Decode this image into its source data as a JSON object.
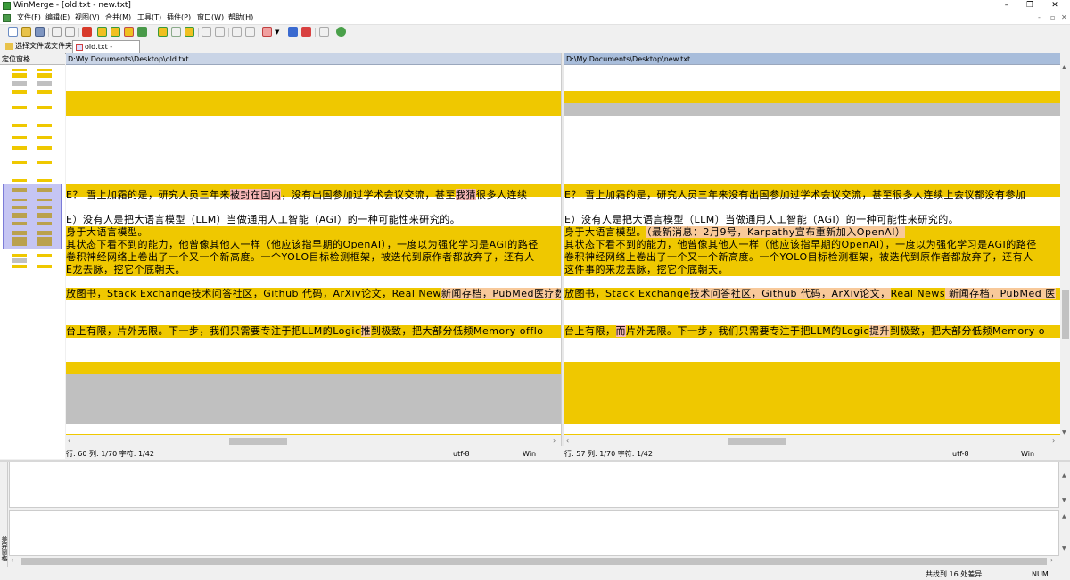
{
  "window": {
    "title": "WinMerge - [old.txt - new.txt]",
    "buttons": {
      "minimize": "–",
      "restore": "❐",
      "close": "✕"
    },
    "mdi_buttons": {
      "minimize": "-",
      "restore": "▫",
      "close": "✕"
    }
  },
  "menu": [
    {
      "label": "文件(F)"
    },
    {
      "label": "编辑(E)"
    },
    {
      "label": "视图(V)"
    },
    {
      "label": "合并(M)"
    },
    {
      "label": "工具(T)"
    },
    {
      "label": "插件(P)"
    },
    {
      "label": "窗口(W)"
    },
    {
      "label": "帮助(H)"
    }
  ],
  "tabs": [
    {
      "label": "选择文件或文件夹"
    },
    {
      "label": "old.txt - new.txt"
    }
  ],
  "location_pane": {
    "title": "定位窗格"
  },
  "left_pane": {
    "path": "D:\\My Documents\\Desktop\\old.txt",
    "lines": [
      {
        "pre": "E？ 雪上加霜的是，研究人员三年来",
        "hl": "被封在国内",
        "post": "，没有出国参加过学术会议交流，甚至",
        "hl2": "我猜",
        "post2": "很多人连续"
      },
      {
        "pre": "E）没有人是把大语言模型（LLM）当做通用人工智能（AGI）的一种可能性来研究的。"
      },
      {
        "pre": "身于大语言模型。"
      },
      {
        "pre": "其状态下看不到的能力，他曾像其他人一样（他应该指早期的OpenAI），一度以为强化学习是AGI的路径"
      },
      {
        "pre": "卷积神经网络上卷出了一个又一个新高度。一个YOLO目标检测框架，被迭代到原作者都放弃了，还有人"
      },
      {
        "pre": "E龙去脉，挖它个底朝天。"
      },
      {
        "pre": "放图书，Stack Exchange技术问答社区，Github 代码，ArXiv论文，Real New",
        "hl": "新闻存档，PubMed医疗数"
      },
      {
        "pre": "台上有限，片外无限。下一步，我们只需要专注于把LLM的Logic",
        "hl": "推",
        "post": "到极致，把大部分低频Memory offlo"
      }
    ],
    "status": {
      "position": "行: 60  列: 1/70  字符: 1/42",
      "encoding": "utf-8",
      "eol": "Win"
    }
  },
  "right_pane": {
    "path": "D:\\My Documents\\Desktop\\new.txt",
    "lines": [
      {
        "pre": "E？ 雪上加霜的是，研究人员三年来没有出国参加过学术会议交流，甚至很多人连续上会议都没有参加"
      },
      {
        "pre": "E）没有人是把大语言模型（LLM）当做通用人工智能（AGI）的一种可能性来研究的。"
      },
      {
        "pre": "身于大语言模型。",
        "hl2": "（最新消息：2月9号，Karpathy宣布重新加入OpenAI）"
      },
      {
        "pre": "其状态下看不到的能力，他曾像其他人一样（他应该指早期的OpenAI），一度以为强化学习是AGI的路径"
      },
      {
        "pre": "卷积神经网络上卷出了一个又一个新高度。一个YOLO目标检测框架，被迭代到原作者都放弃了，还有人"
      },
      {
        "pre": "这件事的来龙去脉，挖它个底朝天。"
      },
      {
        "pre": "放图书，Stack Exchange",
        "hl": "技术问答社区，Github 代码，ArXiv论文，",
        "post": "Real News",
        "hl2": " 新闻存档，PubMed 医"
      },
      {
        "pre": "台上有限，",
        "hl": "而",
        "post": "片外无限。下一步，我们只需要专注于把LLM的Logic",
        "hl2": "提升",
        "post2": "到极致，把大部分低频Memory o"
      }
    ],
    "status": {
      "position": "行: 57  列: 1/70  字符: 1/42",
      "encoding": "utf-8",
      "eol": "Win"
    }
  },
  "bottom_status": {
    "diff_count": "共找到 16 处差异",
    "num": "NUM"
  },
  "side_label": "差异窗格",
  "colors": {
    "diff_yellow": "#efc800",
    "moved_gray": "#c0c0c0",
    "word_diff": "#f5b6b6",
    "word_diff_alt": "#f8c99a"
  }
}
